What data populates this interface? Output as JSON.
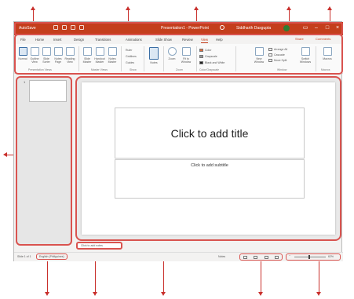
{
  "app": {
    "autosave_label": "AutoSave",
    "doc_title": "Presentation1 - PowerPoint",
    "user_name": "Siddharth Dasgupta"
  },
  "tabs": [
    {
      "label": "File"
    },
    {
      "label": "Home"
    },
    {
      "label": "Insert"
    },
    {
      "label": "Design"
    },
    {
      "label": "Transitions"
    },
    {
      "label": "Animations"
    },
    {
      "label": "Slide Show"
    },
    {
      "label": "Review"
    },
    {
      "label": "View",
      "active": true
    },
    {
      "label": "Help"
    }
  ],
  "tab_actions": {
    "share": "Share",
    "comments": "Comments"
  },
  "ribbon": {
    "presentation_views": [
      "Normal",
      "Outline View",
      "Slide Sorter",
      "Notes Page",
      "Reading View"
    ],
    "master_views": [
      "Slide Master",
      "Handout Master",
      "Notes Master"
    ],
    "show": [
      "Ruler",
      "Gridlines",
      "Guides"
    ],
    "notes": "Notes",
    "zoom": [
      "Zoom",
      "Fit to Window"
    ],
    "color": [
      "Color",
      "Grayscale",
      "Black and White"
    ],
    "window": [
      "New Window",
      "Arrange All",
      "Cascade",
      "Move Split"
    ],
    "switch_windows": "Switch Windows",
    "macros": "Macros",
    "group_labels": [
      "Presentation Views",
      "Master Views",
      "Show",
      "Zoom",
      "Color/Grayscale",
      "Window",
      "Macros"
    ]
  },
  "slide": {
    "number": "1",
    "title_placeholder": "Click to add title",
    "subtitle_placeholder": "Click to add subtitle"
  },
  "notes_placeholder": "Click to add notes",
  "status": {
    "slide_info": "Slide 1 of 1",
    "language": "English (Philippines)",
    "notes_label": "Notes",
    "zoom_level": "62%"
  },
  "colors": {
    "accent": "#c43e1c",
    "callout": "#d9534f"
  }
}
